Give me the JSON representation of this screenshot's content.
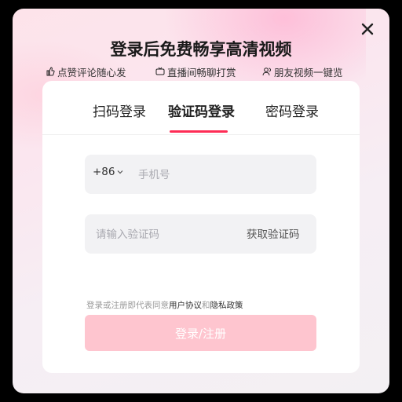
{
  "header": {
    "title": "登录后免费畅享高清视频",
    "close_icon": "close-icon"
  },
  "features": [
    {
      "label": "点赞评论随心发",
      "icon": "thumb-icon"
    },
    {
      "label": "直播间畅聊打赏",
      "icon": "live-icon"
    },
    {
      "label": "朋友视频一键览",
      "icon": "friends-icon"
    }
  ],
  "tabs": [
    {
      "label": "扫码登录",
      "active": false
    },
    {
      "label": "验证码登录",
      "active": true
    },
    {
      "label": "密码登录",
      "active": false
    }
  ],
  "phone": {
    "prefix": "+86",
    "placeholder": "手机号",
    "value": ""
  },
  "code": {
    "placeholder": "请输入验证码",
    "value": "",
    "get_code_label": "获取验证码"
  },
  "error_text": "",
  "agreement": {
    "prefix": "登录或注册即代表同意",
    "user_agreement": "用户协议",
    "conjunction": "和",
    "privacy": "隐私政策"
  },
  "submit_label": "登录/注册",
  "colors": {
    "accent": "#fe2c55",
    "submit_bg": "#fec5cf"
  }
}
